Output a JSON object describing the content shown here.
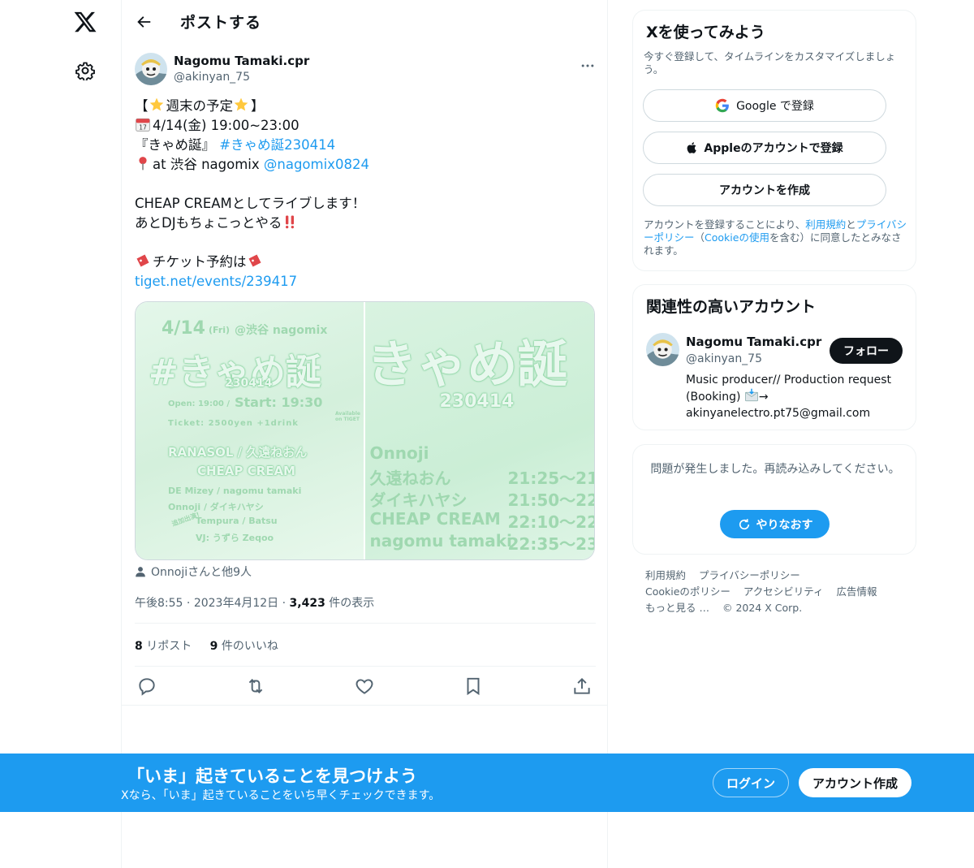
{
  "header": {
    "title": "ポストする"
  },
  "tweet": {
    "author_name": "Nagomu Tamaki.cpr",
    "author_handle": "@akinyan_75",
    "lines": {
      "l1": "【",
      "l1b": "週末の予定",
      "l1c": "】",
      "l2": "4/14(金) 19:00~23:00",
      "l3": "『きゃめ誕』",
      "l3_hashtag": "#きゃめ誕230414",
      "l4": "at 渋谷 nagomix",
      "l4_mention": "@nagomix0824",
      "l5": "CHEAP CREAMとしてライブします！",
      "l6": "あとDJもちょこっとやる",
      "l7": "チケット予約は",
      "l8_link": "tiget.net/events/239417"
    },
    "media": {
      "left": {
        "date": "4/14",
        "dow": "(Fri)",
        "venue": "@渋谷 nagomix",
        "big": "#きゃめ誕",
        "num": "230414",
        "open": "Open: 19:00 /",
        "start": "Start: 19:30",
        "ticket": "Ticket: 2500yen +1drink",
        "available": "Available on TIGET",
        "lineup1": "RANASOL / 久遠ねおん",
        "lineup2": "CHEAP CREAM",
        "lineup3": "DE Mizey / nagomu tamaki",
        "lineup4": "Onnoji / ダイキハヤシ",
        "lineup5": "Tempura / Batsu",
        "lineup6": "VJ: うずら Zeqoo",
        "extra": "追加出演!"
      },
      "right": {
        "big": "きゃめ誕",
        "num": "230414",
        "rows": [
          {
            "name": "Onnoji",
            "time": ""
          },
          {
            "name": "久遠ねおん",
            "time": "21:25～21:"
          },
          {
            "name": "ダイキハヤシ",
            "time": "21:50～22:"
          },
          {
            "name": "CHEAP CREAM",
            "time": "22:10～22:"
          },
          {
            "name": "nagomu tamaki",
            "time": "22:35～23:"
          }
        ]
      }
    },
    "tagged": "Onnojiさんと他9人",
    "time": "午後8:55",
    "date": "2023年4月12日",
    "views_count": "3,423",
    "views_label": "件の表示",
    "reposts_count": "8",
    "reposts_label": "リポスト",
    "likes_count": "9",
    "likes_label": "件のいいね"
  },
  "signup_card": {
    "title": "Xを使ってみよう",
    "subtitle": "今すぐ登録して、タイムラインをカスタマイズしましょう。",
    "google_label": "Google で登録",
    "apple_label": "Appleのアカウントで登録",
    "create_label": "アカウントを作成",
    "legal_pre": "アカウントを登録することにより、",
    "legal_terms": "利用規約",
    "legal_and": "と",
    "legal_privacy": "プライバシーポリシー",
    "legal_mid": "（",
    "legal_cookie": "Cookieの使用",
    "legal_post": "を含む）に同意したとみなされます。"
  },
  "recommended": {
    "title": "関連性の高いアカウント",
    "name": "Nagomu Tamaki.cpr",
    "handle": "@akinyan_75",
    "bio1": "Music producer// Production request",
    "bio2": "(Booking)",
    "bio2b": "→",
    "bio3": "akinyanelectro.pt75@gmail.com",
    "follow_label": "フォロー"
  },
  "error_card": {
    "message": "問題が発生しました。再読み込みしてください。",
    "retry_label": "やりなおす"
  },
  "footer": {
    "terms": "利用規約",
    "privacy": "プライバシーポリシー",
    "cookie": "Cookieのポリシー",
    "accessibility": "アクセシビリティ",
    "ads": "広告情報",
    "more": "もっと見る …",
    "copyright": "© 2024 X Corp."
  },
  "banner": {
    "title": "「いま」起きていることを見つけよう",
    "subtitle": "Xなら、「いま」起きていることをいち早くチェックできます。",
    "login_label": "ログイン",
    "signup_label": "アカウント作成"
  },
  "colors": {
    "accent": "#1d9bf0",
    "text": "#0f1419",
    "muted": "#536471",
    "border": "#eff3f4"
  }
}
